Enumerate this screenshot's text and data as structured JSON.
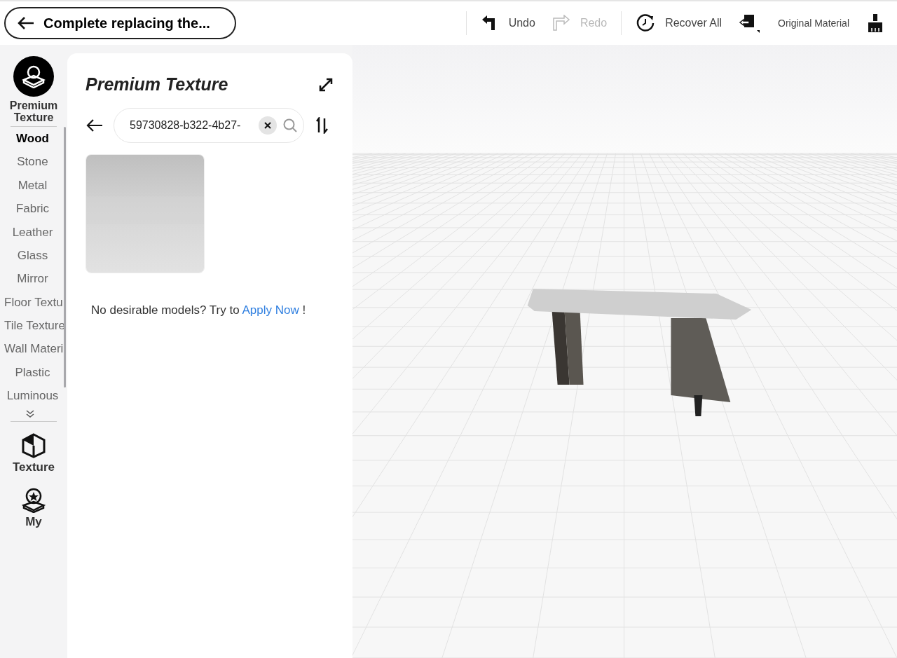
{
  "header": {
    "back_label": "Complete replacing the...",
    "tools": [
      {
        "kind": "undo",
        "label": "Undo",
        "disabled": false
      },
      {
        "kind": "redo",
        "label": "Redo",
        "disabled": true
      },
      {
        "kind": "recover",
        "label": "Recover All",
        "disabled": false
      },
      {
        "kind": "swap",
        "label": "Original Material",
        "disabled": false
      },
      {
        "kind": "brush",
        "disabled": false
      }
    ]
  },
  "sidebar": {
    "top": {
      "label": "Premium Texture"
    },
    "categories": [
      {
        "label": "Wood",
        "selected": true
      },
      {
        "label": "Stone",
        "selected": false
      },
      {
        "label": "Metal",
        "selected": false
      },
      {
        "label": "Fabric",
        "selected": false
      },
      {
        "label": "Leather",
        "selected": false
      },
      {
        "label": "Glass",
        "selected": false
      },
      {
        "label": "Mirror",
        "selected": false
      },
      {
        "label": "Floor Textu",
        "selected": false
      },
      {
        "label": "Tile Texture",
        "selected": false
      },
      {
        "label": "Wall Materi",
        "selected": false
      },
      {
        "label": "Plastic",
        "selected": false
      },
      {
        "label": "Luminous",
        "selected": false
      }
    ],
    "bottom": [
      {
        "kind": "cube",
        "label": "Texture"
      },
      {
        "kind": "star",
        "label": "My"
      }
    ]
  },
  "panel": {
    "title": "Premium Texture",
    "search": {
      "value": "59730828-b322-4b27-"
    },
    "hint": "No desirable models? Try to",
    "link": "Apply Now",
    "hint_end": "!"
  }
}
